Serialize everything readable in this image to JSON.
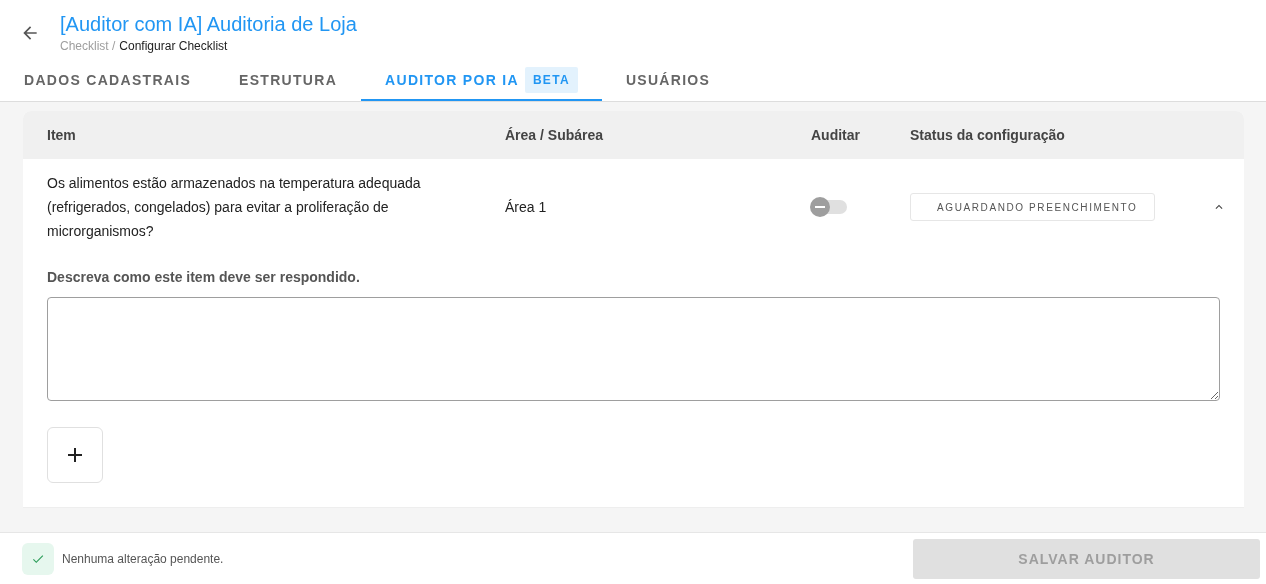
{
  "header": {
    "title": "[Auditor com IA] Auditoria de Loja",
    "breadcrumb": [
      "Checklist /",
      "Configurar Checklist"
    ]
  },
  "tabs": [
    {
      "label": "DADOS CADASTRAIS",
      "selected": false
    },
    {
      "label": "ESTRUTURA",
      "selected": false
    },
    {
      "label": "AUDITOR POR IA",
      "badge": "BETA",
      "selected": true
    },
    {
      "label": "USUÁRIOS",
      "selected": false
    }
  ],
  "table": {
    "columns": [
      "Item",
      "Área / Subárea",
      "Auditar",
      "Status da configuração"
    ],
    "rows": [
      {
        "item": "Os alimentos estão armazenados na temperatura adequada (refrigerados, congelados) para evitar a proliferação de microrganismos?",
        "area": "Área 1",
        "audit_on": false,
        "audit_disabled": true,
        "status": "AGUARDANDO PREENCHIMENTO",
        "expanded": true,
        "description_label": "Descreva como este item deve ser respondido."
      }
    ]
  },
  "footer": {
    "message": "Nenhuma alteração pendente.",
    "save_button": {
      "label": "SALVAR AUDITOR",
      "disabled": true
    }
  }
}
